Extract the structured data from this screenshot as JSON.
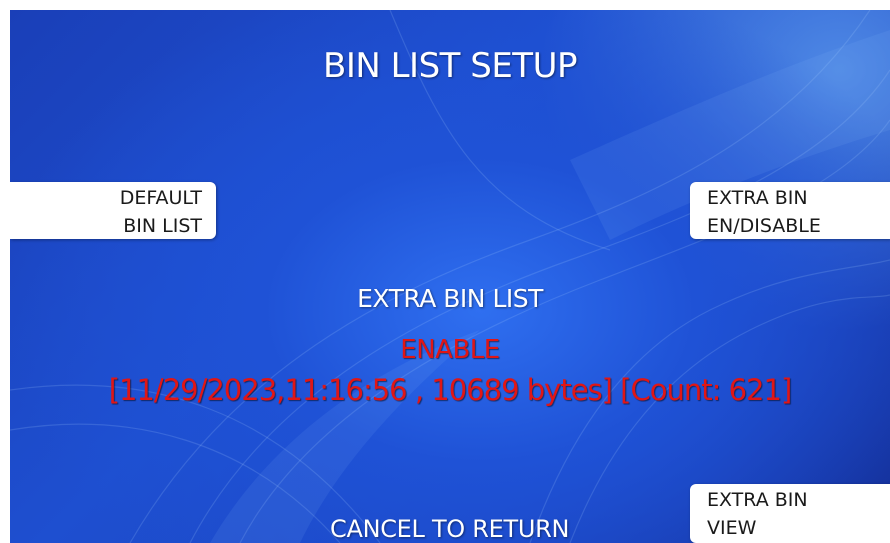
{
  "screen": {
    "title": "BIN LIST SETUP",
    "center_label": "EXTRA BIN LIST",
    "status": "ENABLE",
    "info": "[11/29/2023,11:16:56 , 10689 bytes] [Count: 621]",
    "footer": "CANCEL TO RETURN"
  },
  "keys": {
    "left_1": {
      "line1": "DEFAULT",
      "line2": "BIN LIST"
    },
    "right_1": {
      "line1": "EXTRA BIN",
      "line2": "EN/DISABLE"
    },
    "right_2": {
      "line1": "EXTRA BIN",
      "line2": "VIEW"
    }
  },
  "colors": {
    "background_blue": "#1e4fd0",
    "status_red": "#e01616",
    "key_white": "#ffffff"
  }
}
